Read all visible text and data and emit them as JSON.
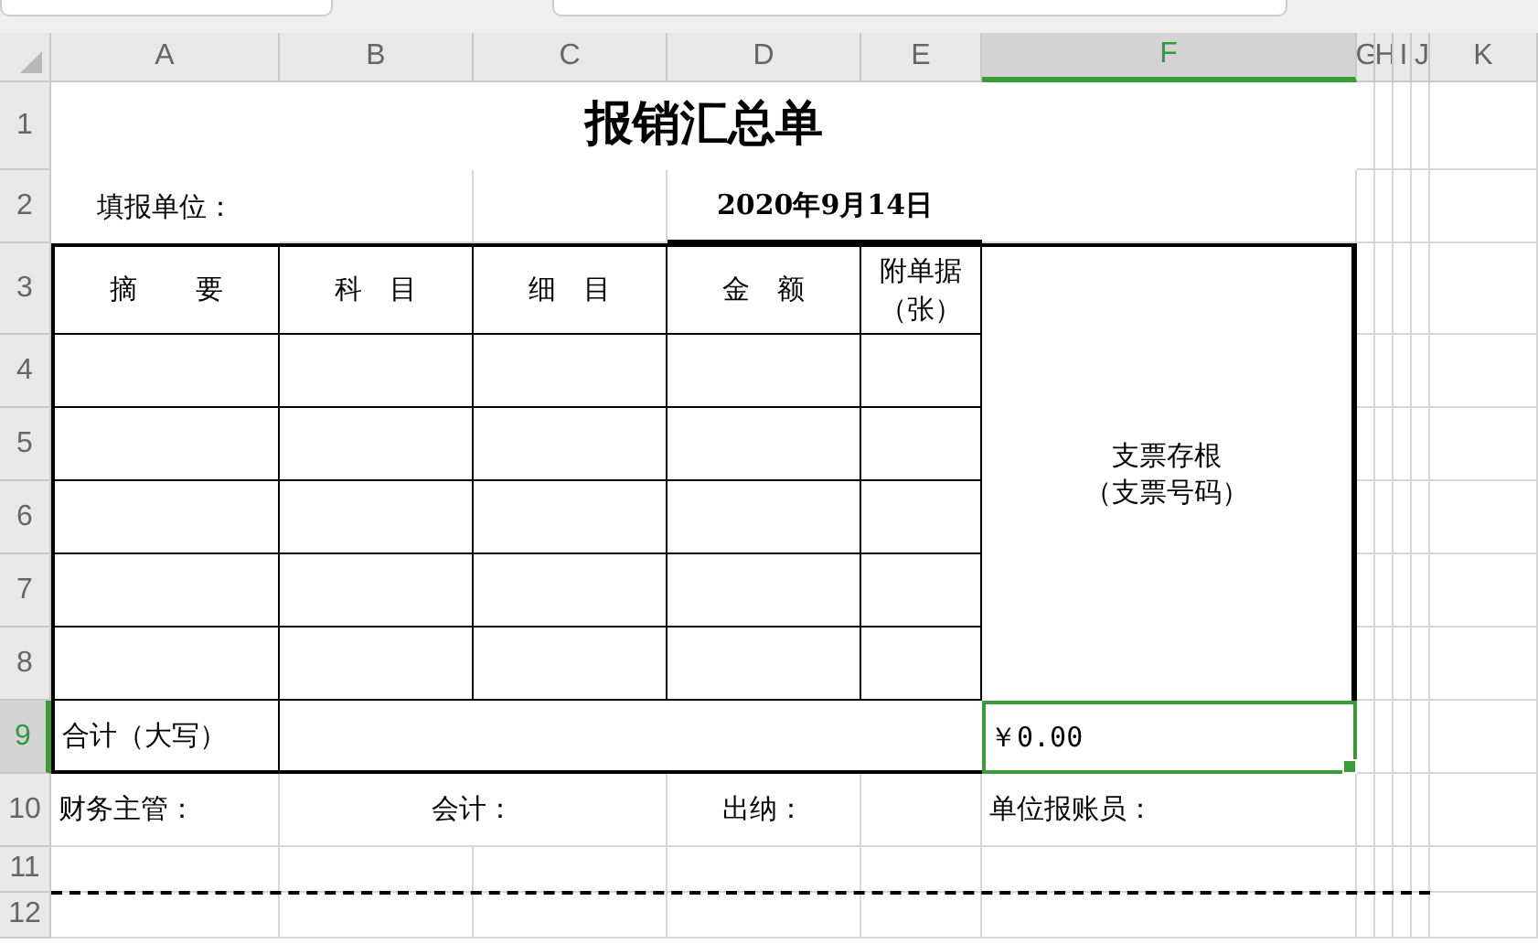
{
  "columns": [
    {
      "label": "A",
      "selected": false
    },
    {
      "label": "B",
      "selected": false
    },
    {
      "label": "C",
      "selected": false
    },
    {
      "label": "D",
      "selected": false
    },
    {
      "label": "E",
      "selected": false
    },
    {
      "label": "F",
      "selected": true
    },
    {
      "label": "G",
      "selected": false
    },
    {
      "label": "H",
      "selected": false
    },
    {
      "label": "I",
      "selected": false
    },
    {
      "label": "J",
      "selected": false
    },
    {
      "label": "K",
      "selected": false
    }
  ],
  "rows": [
    {
      "label": "1",
      "selected": false
    },
    {
      "label": "2",
      "selected": false
    },
    {
      "label": "3",
      "selected": false
    },
    {
      "label": "4",
      "selected": false
    },
    {
      "label": "5",
      "selected": false
    },
    {
      "label": "6",
      "selected": false
    },
    {
      "label": "7",
      "selected": false
    },
    {
      "label": "8",
      "selected": false
    },
    {
      "label": "9",
      "selected": true
    },
    {
      "label": "10",
      "selected": false
    },
    {
      "label": "11",
      "selected": false
    },
    {
      "label": "12",
      "selected": false
    }
  ],
  "title": "报销汇总单",
  "unit_label": "填报单位：",
  "date": "2020年9月14日",
  "headers": [
    "摘要",
    "科目",
    "细目",
    "金额",
    "附单据（张）"
  ],
  "stub": [
    "支票存根",
    "（支票号码）"
  ],
  "total_label": "合计（大写）",
  "total_value": "￥0.00",
  "total_selected": true,
  "signatures": [
    "财务主管：",
    "会计：",
    "出纳：",
    "单位报账员："
  ]
}
